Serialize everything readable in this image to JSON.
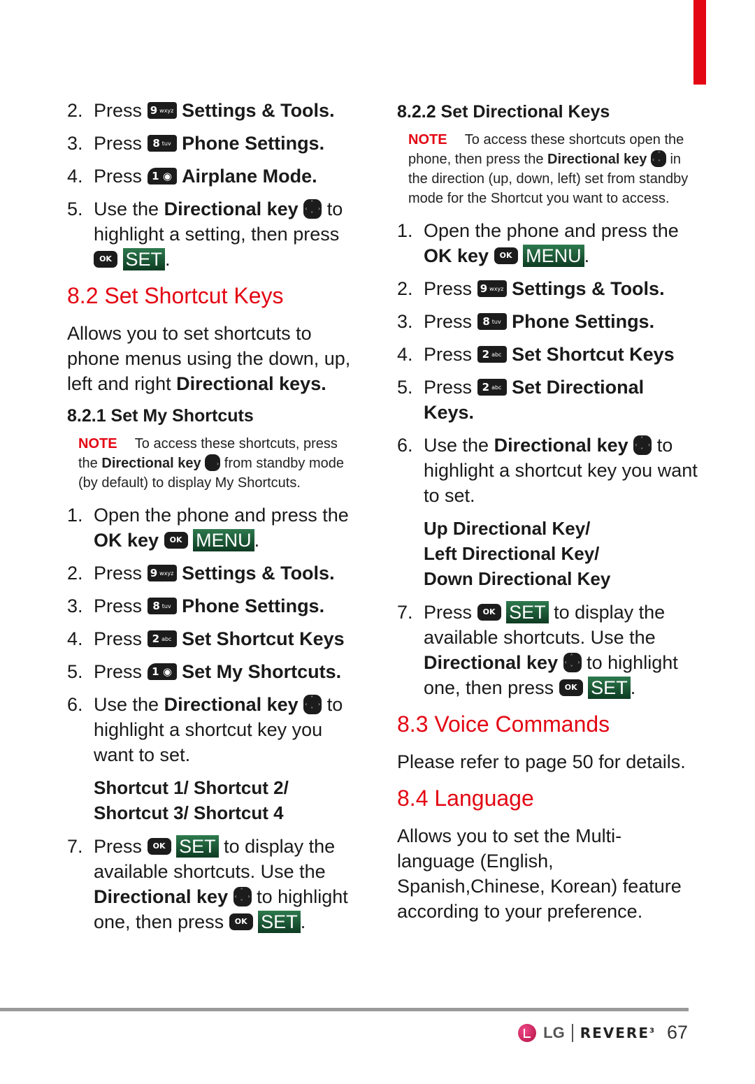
{
  "colors": {
    "accent_red": "#e30613",
    "softkey_green": "#1d5c38",
    "key_black": "#1c1c1c",
    "rule_gray": "#9a9a9a"
  },
  "left": {
    "intro_steps": [
      {
        "num": "2.",
        "pre": "Press",
        "key": {
          "digit": "9",
          "letters": "wxyz"
        },
        "text": "Settings & Tools."
      },
      {
        "num": "3.",
        "pre": "Press",
        "key": {
          "digit": "8",
          "letters": "tuv"
        },
        "text": "Phone Settings."
      },
      {
        "num": "4.",
        "pre": "Press",
        "key": {
          "digit": "1",
          "letters": ""
        },
        "text": "Airplane Mode."
      },
      {
        "num": "5.",
        "pre": "Use the",
        "bold": "Directional key",
        "post": "to highlight a setting, then press",
        "ok": "OK",
        "softkey": "SET"
      }
    ],
    "section_8_2": {
      "title": "8.2 Set Shortcut Keys",
      "desc_pre": "Allows you to set shortcuts to phone menus using the down, up, left and right",
      "desc_bold": "Directional keys."
    },
    "section_8_2_1": {
      "title": "8.2.1 Set My Shortcuts",
      "note_label": "NOTE",
      "note_pre": "To access these shortcuts, press the",
      "note_bold": "Directional key",
      "note_post": "from standby mode (by default) to display My Shortcuts.",
      "steps": [
        {
          "num": "1.",
          "text": "Open the phone and press the",
          "bold": "OK key",
          "ok": "OK",
          "softkey": "MENU"
        },
        {
          "num": "2.",
          "pre": "Press",
          "key": {
            "digit": "9",
            "letters": "wxyz"
          },
          "text": "Settings & Tools."
        },
        {
          "num": "3.",
          "pre": "Press",
          "key": {
            "digit": "8",
            "letters": "tuv"
          },
          "text": "Phone Settings."
        },
        {
          "num": "4.",
          "pre": "Press",
          "key": {
            "digit": "2",
            "letters": "abc"
          },
          "text": "Set Shortcut Keys"
        },
        {
          "num": "5.",
          "pre": "Press",
          "key": {
            "digit": "1",
            "letters": ""
          },
          "text": "Set My Shortcuts."
        },
        {
          "num": "6.",
          "pre": "Use the",
          "bold": "Directional key",
          "post": "to highlight a shortcut key you want to set."
        },
        {
          "num": "7.",
          "pre": "Press",
          "ok": "OK",
          "softkey": "SET",
          "post": "to display the available shortcuts. Use the",
          "bold": "Directional key",
          "post2": "to highlight one, then press",
          "softkey2": "SET"
        }
      ],
      "options": [
        "Shortcut 1/ Shortcut 2/",
        "Shortcut 3/ Shortcut 4"
      ]
    }
  },
  "right": {
    "section_8_2_2": {
      "title": "8.2.2 Set Directional Keys",
      "note_label": "NOTE",
      "note_pre": "To access these shortcuts open the phone, then press the",
      "note_bold1": "Directional",
      "note_bold2": "key",
      "note_post": "in the direction (up, down, left) set from standby mode for the Shortcut you want to access.",
      "steps": [
        {
          "num": "1.",
          "text": "Open the phone and press the",
          "bold": "OK key",
          "ok": "OK",
          "softkey": "MENU"
        },
        {
          "num": "2.",
          "pre": "Press",
          "key": {
            "digit": "9",
            "letters": "wxyz"
          },
          "text": "Settings & Tools."
        },
        {
          "num": "3.",
          "pre": "Press",
          "key": {
            "digit": "8",
            "letters": "tuv"
          },
          "text": "Phone Settings."
        },
        {
          "num": "4.",
          "pre": "Press",
          "key": {
            "digit": "2",
            "letters": "abc"
          },
          "text": "Set Shortcut Keys"
        },
        {
          "num": "5.",
          "pre": "Press",
          "key": {
            "digit": "2",
            "letters": "abc"
          },
          "text": "Set Directional Keys."
        },
        {
          "num": "6.",
          "pre": "Use the",
          "bold": "Directional key",
          "post": "to highlight a shortcut key you want to set."
        },
        {
          "num": "7.",
          "pre": "Press",
          "ok": "OK",
          "softkey": "SET",
          "post": "to display the available shortcuts. Use the",
          "bold": "Directional key",
          "post2": "to highlight one, then press",
          "softkey2": "SET"
        }
      ],
      "options": [
        "Up Directional Key/",
        "Left Directional Key/",
        "Down Directional Key"
      ]
    },
    "section_8_3": {
      "title": "8.3 Voice Commands",
      "desc": "Please refer to page 50 for details."
    },
    "section_8_4": {
      "title": "8.4 Language",
      "desc": "Allows you to set the Multi-language (English, Spanish,Chinese, Korean) feature according to your preference."
    }
  },
  "footer": {
    "brand_lg": "LG",
    "product": "REVERE",
    "product_sup": "3",
    "page_number": "67"
  },
  "punct": {
    "period": "."
  }
}
